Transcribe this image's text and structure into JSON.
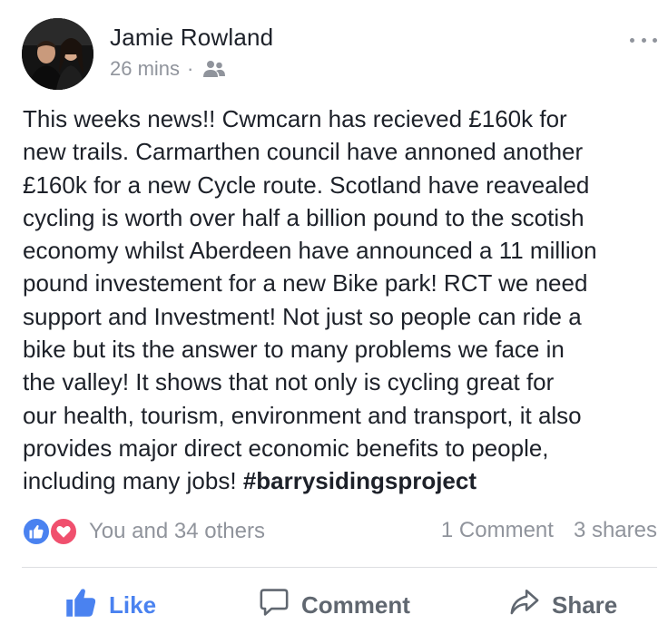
{
  "post": {
    "author": "Jamie Rowland",
    "timestamp": "26 mins",
    "separator": "·",
    "audience_icon": "friends-icon",
    "more_icon": "more-options-icon",
    "text_lines": [
      "This weeks news!! Cwmcarn has recieved £160k for",
      "new trails. Carmarthen council have annoned another",
      "£160k for a new Cycle route. Scotland have reavealed",
      "cycling is worth over half a billion pound to the scotish",
      "economy whilst Aberdeen have announced a 11 million",
      "pound investement for a new Bike park! RCT we need",
      "support and Investment! Not just so people can ride a",
      "bike but its the answer to many problems we face in",
      "the valley! It shows that not only is cycling great for",
      "our health, tourism, environment and transport, it also",
      "provides major direct economic benefits to people,",
      "including many jobs!"
    ],
    "hashtag": "#barrysidingsproject"
  },
  "reactions": {
    "icons": [
      "like-reaction-icon",
      "love-reaction-icon"
    ],
    "summary": "You and 34 others",
    "comments": "1 Comment",
    "shares": "3 shares"
  },
  "actions": {
    "like": "Like",
    "comment": "Comment",
    "share": "Share"
  },
  "colors": {
    "accent": "#4a82f0",
    "love": "#f0506e",
    "muted": "#90949c",
    "text": "#1d2129"
  }
}
